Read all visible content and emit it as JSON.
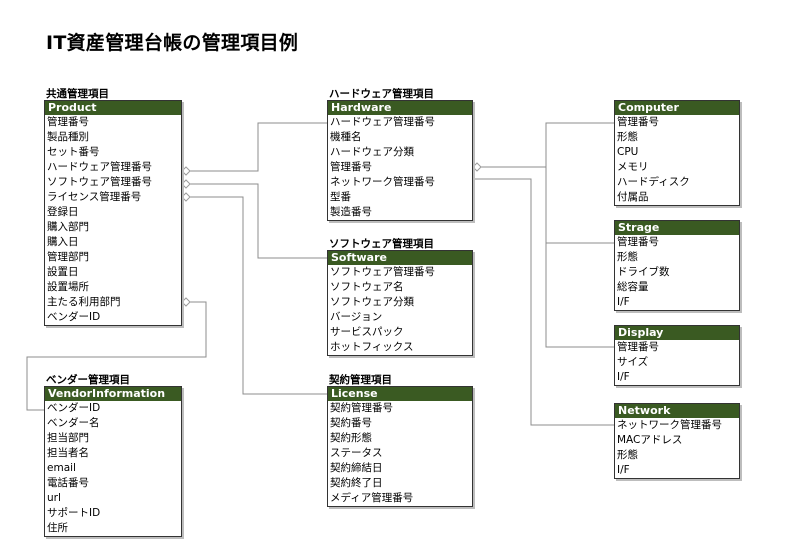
{
  "title": "IT資産管理台帳の管理項目例",
  "entities": {
    "product": {
      "group": "共通管理項目",
      "name": "Product",
      "fields": [
        "管理番号",
        "製品種別",
        "セット番号",
        "ハードウェア管理番号",
        "ソフトウェア管理番号",
        "ライセンス管理番号",
        "登録日",
        "購入部門",
        "購入日",
        "管理部門",
        "設置日",
        "設置場所",
        "主たる利用部門",
        "ベンダーID"
      ]
    },
    "hardware": {
      "group": "ハードウェア管理項目",
      "name": "Hardware",
      "fields": [
        "ハードウェア管理番号",
        "機種名",
        "ハードウェア分類",
        "管理番号",
        "ネットワーク管理番号",
        "型番",
        "製造番号"
      ]
    },
    "software": {
      "group": "ソフトウェア管理項目",
      "name": "Software",
      "fields": [
        "ソフトウェア管理番号",
        "ソフトウェア名",
        "ソフトウェア分類",
        "バージョン",
        "サービスパック",
        "ホットフィックス"
      ]
    },
    "license": {
      "group": "契約管理項目",
      "name": "License",
      "fields": [
        "契約管理番号",
        "契約番号",
        "契約形態",
        "ステータス",
        "契約締結日",
        "契約終了日",
        "メディア管理番号"
      ]
    },
    "vendor": {
      "group": "ベンダー管理項目",
      "name": "VendorInformation",
      "fields": [
        "ベンダーID",
        "ベンダー名",
        "担当部門",
        "担当者名",
        "email",
        "電話番号",
        "url",
        "サポートID",
        "住所"
      ]
    },
    "computer": {
      "name": "Computer",
      "fields": [
        "管理番号",
        "形態",
        "CPU",
        "メモリ",
        "ハードディスク",
        "付属品"
      ]
    },
    "strage": {
      "name": "Strage",
      "fields": [
        "管理番号",
        "形態",
        "ドライブ数",
        "総容量",
        "I/F"
      ]
    },
    "display": {
      "name": "Display",
      "fields": [
        "管理番号",
        "サイズ",
        "I/F"
      ]
    },
    "network": {
      "name": "Network",
      "fields": [
        "ネットワーク管理番号",
        "MACアドレス",
        "形態",
        "I/F"
      ]
    }
  },
  "colors": {
    "header_bg": "#3a5a22",
    "header_text": "#ffffff",
    "connector": "#8c8c8c"
  }
}
